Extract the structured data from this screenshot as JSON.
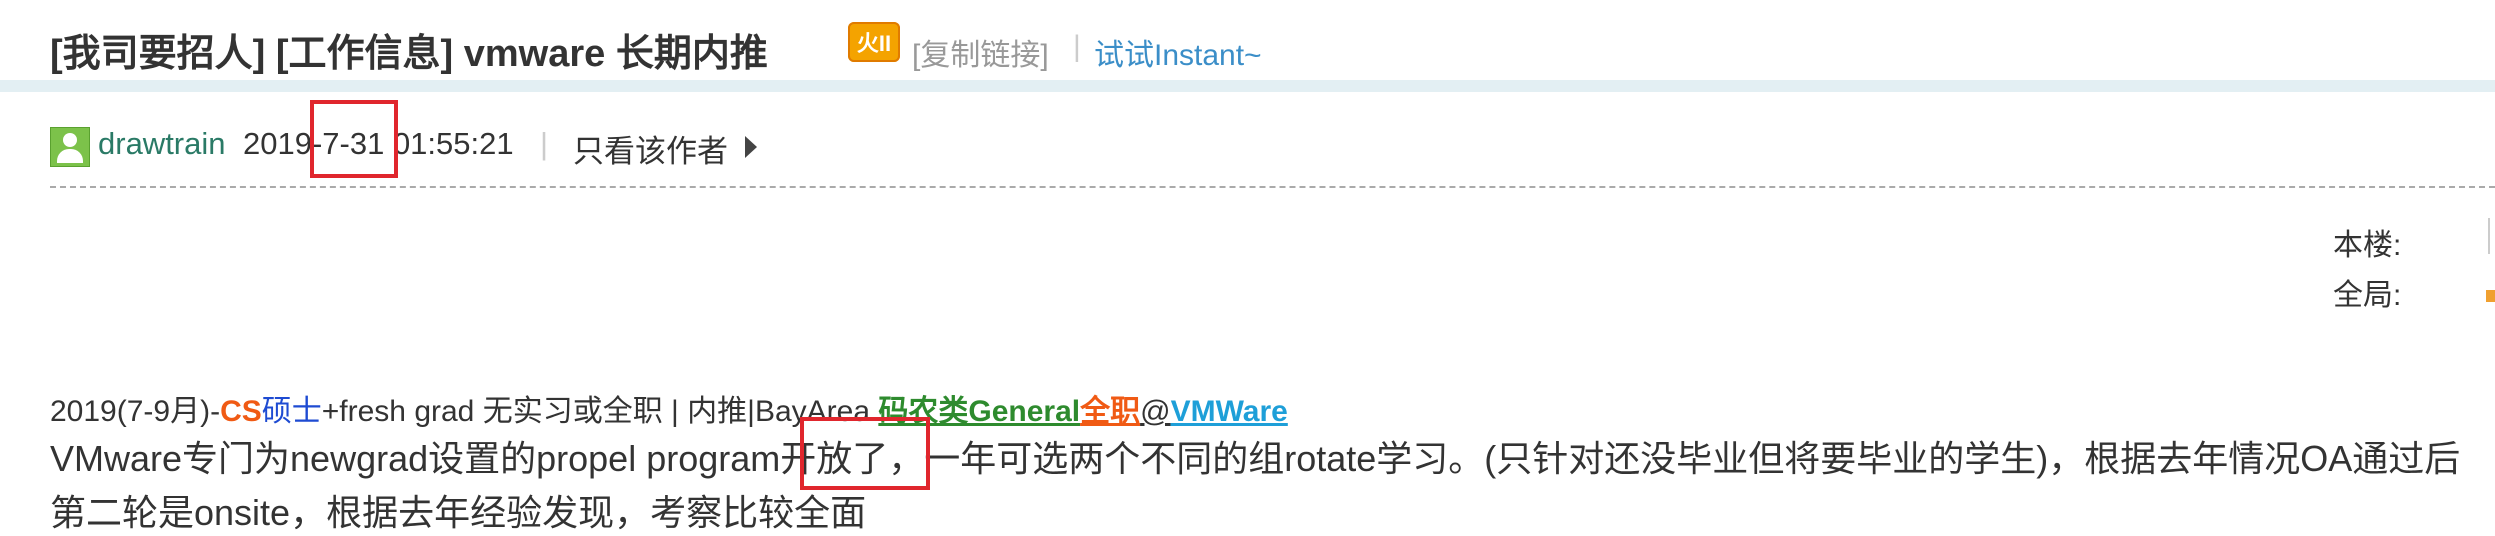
{
  "header": {
    "title": "[我司要招人] [工作信息] vmware 长期内推",
    "badge": "火II",
    "copy_link": "[复制链接]",
    "separator": "|",
    "try_instant": "试试Instant~"
  },
  "author": {
    "name": "drawtrain",
    "datetime": "2019-7-31 01:55:21",
    "separator": "|",
    "only_author": "只看该作者"
  },
  "sidebar_labels": {
    "this_floor": "本楼:",
    "global": "全局:"
  },
  "post": {
    "tag_prefix": "2019(7-9月)-",
    "tag_cs": "CS",
    "tag_master": "硕士",
    "tag_middle": "+fresh grad 无实习或全职 | 内推|BayArea ",
    "tag_category": "码农类General",
    "tag_fulltime": "全职",
    "tag_at": "@",
    "tag_company": "VMWare",
    "content_line1": "VMware专门为newgrad设置的propel program开放了，一年可选两个不同的组rotate学习。(只针对还没毕业但将要毕业的学生)，根据去年情况OA通过后",
    "content_line2": "第二轮是onsite，根据去年经验发现，考察比较全面"
  },
  "colors": {
    "highlight": "#e0262d",
    "author_name": "#2a7a66",
    "link": "#3b8ec8",
    "cs_orange": "#f05a14",
    "category_green": "#2e8b2e",
    "company_blue": "#1e9fd8"
  }
}
